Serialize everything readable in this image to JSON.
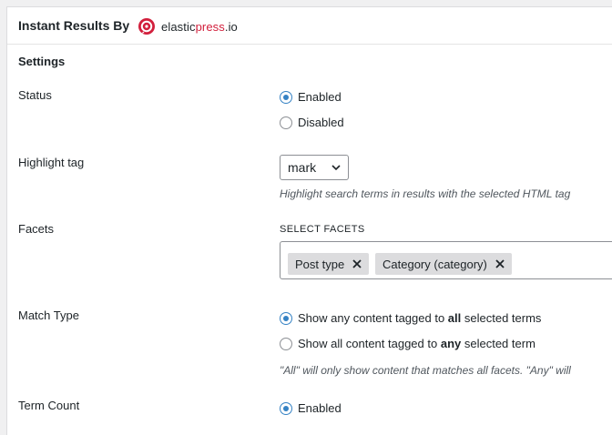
{
  "header": {
    "title": "Instant Results By",
    "logo": {
      "icon": "elasticpress-logo-icon",
      "brand_part1": "elastic",
      "brand_part2": "press",
      "brand_part3": ".io",
      "brand_color": "#d21f3c"
    }
  },
  "settings": {
    "title": "Settings",
    "status": {
      "label": "Status",
      "options": [
        {
          "label": "Enabled",
          "checked": true
        },
        {
          "label": "Disabled",
          "checked": false
        }
      ]
    },
    "highlight_tag": {
      "label": "Highlight tag",
      "selected": "mark",
      "description": "Highlight search terms in results with the selected HTML tag"
    },
    "facets": {
      "label": "Facets",
      "caption": "SELECT FACETS",
      "selected": [
        {
          "label": "Post type"
        },
        {
          "label": "Category (category)"
        }
      ]
    },
    "match_type": {
      "label": "Match Type",
      "options": [
        {
          "prefix": "Show any content tagged to ",
          "bold": "all",
          "suffix": " selected terms",
          "checked": true
        },
        {
          "prefix": "Show all content tagged to ",
          "bold": "any",
          "suffix": " selected term",
          "checked": false
        }
      ],
      "description": "\"All\" will only show content that matches all facets. \"Any\" will"
    },
    "term_count": {
      "label": "Term Count",
      "options": [
        {
          "label": "Enabled",
          "checked": true
        }
      ]
    }
  },
  "colors": {
    "accent": "#3582c4",
    "text": "#1d2327",
    "muted": "#50575e",
    "chip_bg": "#dcdcde"
  }
}
